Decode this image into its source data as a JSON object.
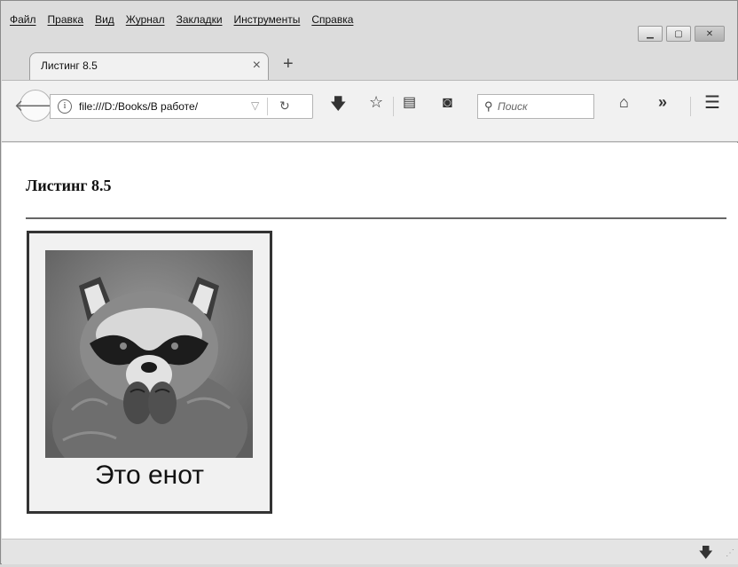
{
  "menu": [
    "Файл",
    "Правка",
    "Вид",
    "Журнал",
    "Закладки",
    "Инструменты",
    "Справка"
  ],
  "tab": {
    "title": "Листинг 8.5",
    "close": "×",
    "new": "+"
  },
  "navbar": {
    "url": "file:///D:/Books/В работе/",
    "search_placeholder": "Поиск"
  },
  "page": {
    "heading": "Листинг 8.5",
    "figure_caption": "Это енот"
  }
}
